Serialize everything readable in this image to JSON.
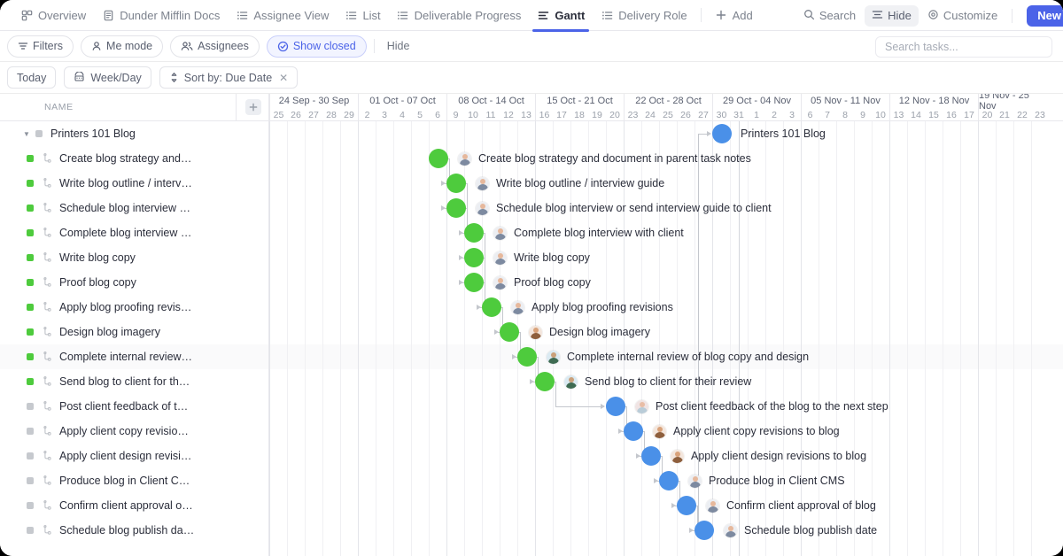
{
  "view_tabs": [
    {
      "label": "Overview",
      "icon": "overview-icon",
      "active": false
    },
    {
      "label": "Dunder Mifflin Docs",
      "icon": "doc-icon",
      "active": false
    },
    {
      "label": "Assignee View",
      "icon": "list-icon",
      "active": false
    },
    {
      "label": "List",
      "icon": "list-icon",
      "active": false
    },
    {
      "label": "Deliverable Progress",
      "icon": "list-icon",
      "active": false
    },
    {
      "label": "Gantt",
      "icon": "gantt-icon",
      "active": true
    },
    {
      "label": "Delivery Role",
      "icon": "list-icon",
      "active": false
    }
  ],
  "add_view_label": "Add",
  "view_actions": {
    "search_label": "Search",
    "hide_label": "Hide",
    "customize_label": "Customize",
    "new_label": "New"
  },
  "filters": {
    "filters_label": "Filters",
    "me_mode_label": "Me mode",
    "assignees_label": "Assignees",
    "show_closed_label": "Show closed",
    "hide_label": "Hide",
    "search_placeholder": "Search tasks...",
    "search_value": ""
  },
  "subbar": {
    "today_label": "Today",
    "zoom_label": "Week/Day",
    "sort_label": "Sort by: Due Date"
  },
  "name_column": {
    "header": "NAME",
    "add_column_label": "+"
  },
  "colors": {
    "accent": "#4b63e8",
    "milestone_green": "#4ecb3d",
    "milestone_blue": "#4a90e8",
    "status_green": "#4ecb3d",
    "status_gray": "#c6c9ce"
  },
  "chart_data": {
    "type": "gantt",
    "title": "Printers 101 Blog",
    "zoom": "Week/Day",
    "sort": "Due Date",
    "weeks": [
      {
        "label": "24 Sep - 30 Sep",
        "days": [
          "25",
          "26",
          "27",
          "28",
          "29"
        ]
      },
      {
        "label": "01 Oct - 07 Oct",
        "days": [
          "2",
          "3",
          "4",
          "5",
          "6"
        ]
      },
      {
        "label": "08 Oct - 14 Oct",
        "days": [
          "9",
          "10",
          "11",
          "12",
          "13"
        ]
      },
      {
        "label": "15 Oct - 21 Oct",
        "days": [
          "16",
          "17",
          "18",
          "19",
          "20"
        ]
      },
      {
        "label": "22 Oct - 28 Oct",
        "days": [
          "23",
          "24",
          "25",
          "26",
          "27"
        ]
      },
      {
        "label": "29 Oct - 04 Nov",
        "days": [
          "30",
          "31",
          "1",
          "2",
          "3"
        ]
      },
      {
        "label": "05 Nov - 11 Nov",
        "days": [
          "6",
          "7",
          "8",
          "9",
          "10"
        ]
      },
      {
        "label": "12 Nov - 18 Nov",
        "days": [
          "13",
          "14",
          "15",
          "16",
          "17"
        ]
      },
      {
        "label": "19 Nov - 25 Nov",
        "days": [
          "20",
          "21",
          "22",
          "23"
        ]
      }
    ],
    "today_index": 26,
    "rows": [
      {
        "name": "Printers 101 Blog",
        "short": "Printers 101 Blog",
        "type": "parent",
        "status": "gray",
        "milestone": "blue",
        "day_index": 25
      },
      {
        "name": "Create blog strategy and document in parent task notes",
        "short": "Create blog strategy and…",
        "type": "task",
        "status": "green",
        "milestone": "green",
        "day_index": 9,
        "avatar": "a1"
      },
      {
        "name": "Write blog outline / interview guide",
        "short": "Write blog outline / interv…",
        "type": "task",
        "status": "green",
        "milestone": "green",
        "day_index": 10,
        "avatar": "a1"
      },
      {
        "name": "Schedule blog interview or send interview guide to client",
        "short": "Schedule blog interview …",
        "type": "task",
        "status": "green",
        "milestone": "green",
        "day_index": 10,
        "avatar": "a1"
      },
      {
        "name": "Complete blog interview with client",
        "short": "Complete blog interview …",
        "type": "task",
        "status": "green",
        "milestone": "green",
        "day_index": 11,
        "avatar": "a1"
      },
      {
        "name": "Write blog copy",
        "short": "Write blog copy",
        "type": "task",
        "status": "green",
        "milestone": "green",
        "day_index": 11,
        "avatar": "a1"
      },
      {
        "name": "Proof blog copy",
        "short": "Proof blog copy",
        "type": "task",
        "status": "green",
        "milestone": "green",
        "day_index": 11,
        "avatar": "a1"
      },
      {
        "name": "Apply blog proofing revisions",
        "short": "Apply blog proofing revis…",
        "type": "task",
        "status": "green",
        "milestone": "green",
        "day_index": 12,
        "avatar": "a1"
      },
      {
        "name": "Design blog imagery",
        "short": "Design blog imagery",
        "type": "task",
        "status": "green",
        "milestone": "green",
        "day_index": 13,
        "avatar": "a2"
      },
      {
        "name": "Complete internal review of blog copy and design",
        "short": "Complete internal review…",
        "type": "task",
        "status": "green",
        "milestone": "green",
        "day_index": 14,
        "avatar": "a3"
      },
      {
        "name": "Send blog to client for their review",
        "short": "Send blog to client for th…",
        "type": "task",
        "status": "green",
        "milestone": "green",
        "day_index": 15,
        "avatar": "a3"
      },
      {
        "name": "Post client feedback of the blog to the next step",
        "short": "Post client feedback of t…",
        "type": "task",
        "status": "gray",
        "milestone": "blue",
        "day_index": 19,
        "avatar": "a4"
      },
      {
        "name": "Apply client copy revisions to blog",
        "short": "Apply client copy revisio…",
        "type": "task",
        "status": "gray",
        "milestone": "blue",
        "day_index": 20,
        "avatar": "a2"
      },
      {
        "name": "Apply client design revisions to blog",
        "short": "Apply client design revisi…",
        "type": "task",
        "status": "gray",
        "milestone": "blue",
        "day_index": 21,
        "avatar": "a2"
      },
      {
        "name": "Produce blog in Client CMS",
        "short": "Produce blog in Client C…",
        "type": "task",
        "status": "gray",
        "milestone": "blue",
        "day_index": 22,
        "avatar": "a1"
      },
      {
        "name": "Confirm client approval of blog",
        "short": "Confirm client approval o…",
        "type": "task",
        "status": "gray",
        "milestone": "blue",
        "day_index": 23,
        "avatar": "a1"
      },
      {
        "name": "Schedule blog publish date",
        "short": "Schedule blog publish da…",
        "type": "task",
        "status": "gray",
        "milestone": "blue",
        "day_index": 24,
        "avatar": "a1"
      }
    ]
  }
}
